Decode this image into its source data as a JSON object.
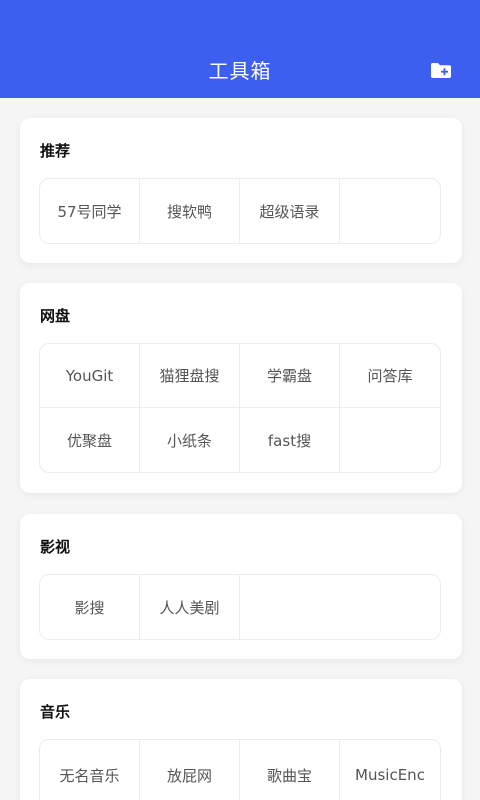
{
  "header": {
    "title": "工具箱",
    "action_icon": "folder-add-icon",
    "bg_color": "#3d5ff0"
  },
  "sections": [
    {
      "key": "recommended",
      "title": "推荐",
      "items": [
        {
          "label": "57号同学"
        },
        {
          "label": "搜软鸭"
        },
        {
          "label": "超级语录"
        },
        {
          "label": ""
        }
      ]
    },
    {
      "key": "netdisk",
      "title": "网盘",
      "items": [
        {
          "label": "YouGit"
        },
        {
          "label": "猫狸盘搜"
        },
        {
          "label": "学霸盘"
        },
        {
          "label": "问答库"
        },
        {
          "label": "优聚盘"
        },
        {
          "label": "小纸条"
        },
        {
          "label": "fast搜"
        },
        {
          "label": ""
        }
      ]
    },
    {
      "key": "video",
      "title": "影视",
      "items": [
        {
          "label": "影搜"
        },
        {
          "label": "人人美剧"
        }
      ]
    },
    {
      "key": "music",
      "title": "音乐",
      "items": [
        {
          "label": "无名音乐"
        },
        {
          "label": "放屁网"
        },
        {
          "label": "歌曲宝"
        },
        {
          "label": "MusicEnc"
        }
      ]
    }
  ]
}
